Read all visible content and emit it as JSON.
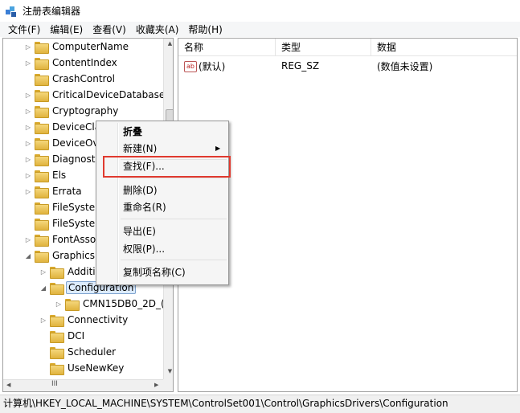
{
  "window": {
    "title": "注册表编辑器"
  },
  "menubar": [
    {
      "label": "文件(F)"
    },
    {
      "label": "编辑(E)"
    },
    {
      "label": "查看(V)"
    },
    {
      "label": "收藏夹(A)"
    },
    {
      "label": "帮助(H)"
    }
  ],
  "tree": [
    {
      "label": "ComputerName",
      "expander": "▷"
    },
    {
      "label": "ContentIndex",
      "expander": "▷"
    },
    {
      "label": "CrashControl",
      "expander": ""
    },
    {
      "label": "CriticalDeviceDatabase",
      "expander": "▷"
    },
    {
      "label": "Cryptography",
      "expander": "▷"
    },
    {
      "label": "DeviceCla",
      "expander": "▷"
    },
    {
      "label": "DeviceOv",
      "expander": "▷"
    },
    {
      "label": "Diagnosti",
      "expander": "▷"
    },
    {
      "label": "Els",
      "expander": "▷"
    },
    {
      "label": "Errata",
      "expander": "▷"
    },
    {
      "label": "FileSysten",
      "expander": ""
    },
    {
      "label": "FileSysten",
      "expander": ""
    },
    {
      "label": "FontAssoc",
      "expander": "▷"
    },
    {
      "label": "GraphicsD",
      "expander": "◢"
    },
    {
      "label": "Additio",
      "expander": "▷"
    },
    {
      "label": "Configuration",
      "expander": "◢",
      "selected": true
    },
    {
      "label": "CMN15DB0_2D_(",
      "expander": "▷"
    },
    {
      "label": "Connectivity",
      "expander": "▷"
    },
    {
      "label": "DCI",
      "expander": ""
    },
    {
      "label": "Scheduler",
      "expander": ""
    },
    {
      "label": "UseNewKey",
      "expander": ""
    }
  ],
  "scroll": {
    "grip": "III",
    "left": "◀",
    "right": "▶",
    "up": "▲",
    "down": "▼"
  },
  "list": {
    "columns": [
      "名称",
      "类型",
      "数据"
    ],
    "rows": [
      {
        "icon": "ab",
        "name": "(默认)",
        "type": "REG_SZ",
        "data": "(数值未设置)"
      }
    ]
  },
  "context_menu": {
    "items": [
      "折叠",
      "新建(N)",
      "查找(F)...",
      "删除(D)",
      "重命名(R)",
      "导出(E)",
      "权限(P)...",
      "复制项名称(C)"
    ],
    "submenu_arrow": "▶"
  },
  "status": {
    "path": "计算机\\HKEY_LOCAL_MACHINE\\SYSTEM\\ControlSet001\\Control\\GraphicsDrivers\\Configuration"
  },
  "colors": {
    "highlight_box": "#e03a2f",
    "selection": "#dcebfc"
  }
}
